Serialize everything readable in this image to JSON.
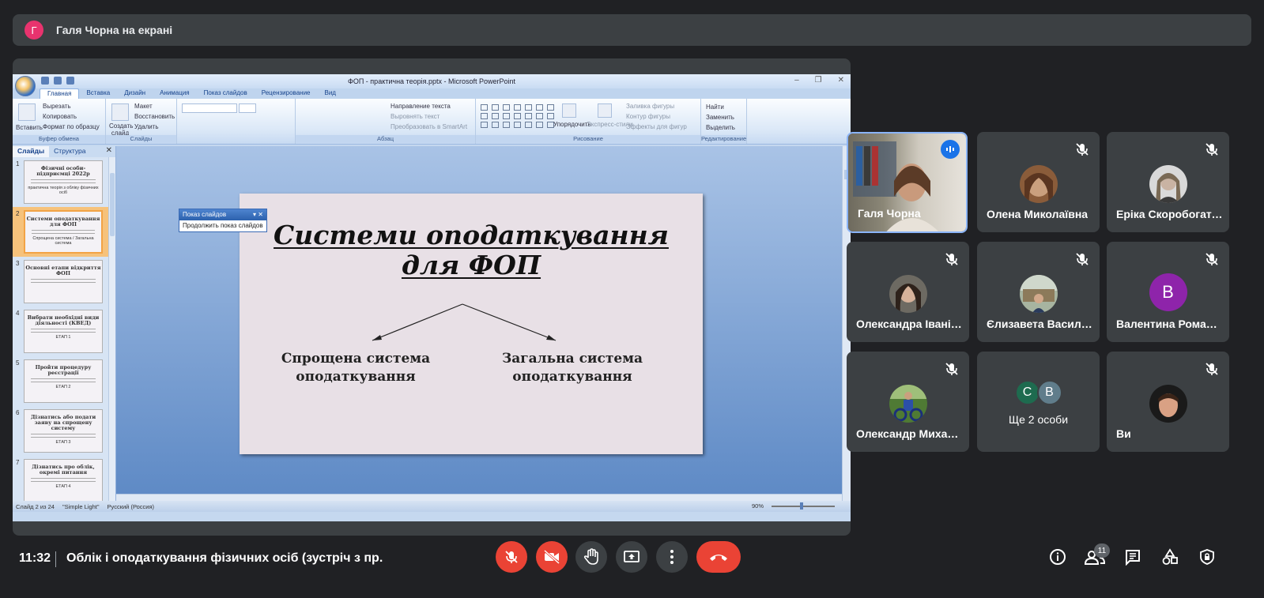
{
  "presenter": {
    "avatar_letter": "Г",
    "text": "Галя Чорна на екрані"
  },
  "powerpoint": {
    "window_title": "ФОП - практична теорія.pptx - Microsoft PowerPoint",
    "tabs": [
      "Главная",
      "Вставка",
      "Дизайн",
      "Анимация",
      "Показ слайдов",
      "Рецензирование",
      "Вид"
    ],
    "clipboard": {
      "paste": "Вставить",
      "cut": "Вырезать",
      "copy": "Копировать",
      "format_painter": "Формат по образцу",
      "group": "Буфер обмена"
    },
    "slides_group": {
      "new_slide": "Создать слайд",
      "layout": "Макет",
      "reset": "Восстановить",
      "delete": "Удалить",
      "group": "Слайды"
    },
    "paragraph_group": {
      "text_direction": "Направление текста",
      "align_text": "Выровнять текст",
      "smartart": "Преобразовать в SmartArt",
      "group": "Абзац"
    },
    "drawing_group": {
      "arrange": "Упорядочить",
      "quick_styles": "Экспресс-стили",
      "shape_fill": "Заливка фигуры",
      "shape_outline": "Контур фигуры",
      "shape_effects": "Эффекты для фигур",
      "group": "Рисование"
    },
    "editing_group": {
      "find": "Найти",
      "replace": "Заменить",
      "select": "Выделить",
      "group": "Редактирование"
    },
    "panel_tabs": [
      "Слайды",
      "Структура"
    ],
    "popup": {
      "title": "Показ слайдов",
      "item": "Продолжить показ слайдов"
    },
    "thumbnails": [
      {
        "num": "1",
        "title": "Фізичні особи-підприємці 2022р",
        "sub": "практична теорія з обліку фізичних осіб"
      },
      {
        "num": "2",
        "title": "Системи оподаткування для ФОП",
        "sub": "Спрощена система / Загальна система"
      },
      {
        "num": "3",
        "title": "Основні етапи відкриття ФОП",
        "sub": ""
      },
      {
        "num": "4",
        "title": "Вибрати необхідні види діяльності (КВЕД)",
        "sub": "ЕТАП 1"
      },
      {
        "num": "5",
        "title": "Пройти процедуру реєстрації",
        "sub": "ЕТАП 2"
      },
      {
        "num": "6",
        "title": "Дізнатись або подати заяву на спрощену систему",
        "sub": "ЕТАП 3"
      },
      {
        "num": "7",
        "title": "Дізнатись про облік, окремі питання",
        "sub": "ЕТАП 4"
      }
    ],
    "slide": {
      "title_line1": "Системи оподаткування",
      "title_line2": "для ФОП",
      "left_line1": "Спрощена система",
      "left_line2": "оподаткування",
      "right_line1": "Загальна система",
      "right_line2": "оподаткування"
    },
    "status": {
      "slide_of": "Слайд 2 из 24",
      "theme": "\"Simple Light\"",
      "language": "Русский (Россия)",
      "zoom": "90%"
    }
  },
  "participants": [
    {
      "name": "Галя Чорна",
      "speaking": true
    },
    {
      "name": "Олена Миколаївна"
    },
    {
      "name": "Еріка Скоробогатова"
    },
    {
      "name": "Олександра Іванівна"
    },
    {
      "name": "Єлизавета Василівна"
    },
    {
      "name": "Валентина Романівна",
      "letter": "В"
    },
    {
      "name": "Олександр Михайлович"
    },
    {
      "name": "Ще 2 особи",
      "letters": [
        "С",
        "В"
      ]
    },
    {
      "name": "Ви"
    }
  ],
  "bottom": {
    "time": "11:32",
    "meeting_title": "Облік і оподаткування фізичних осіб (зустріч з пр...",
    "participants_count": "11"
  },
  "colors": {
    "end_call": "#ea4335",
    "accent": "#1a73e8",
    "tile": "#3c4043",
    "bg": "#202124"
  }
}
